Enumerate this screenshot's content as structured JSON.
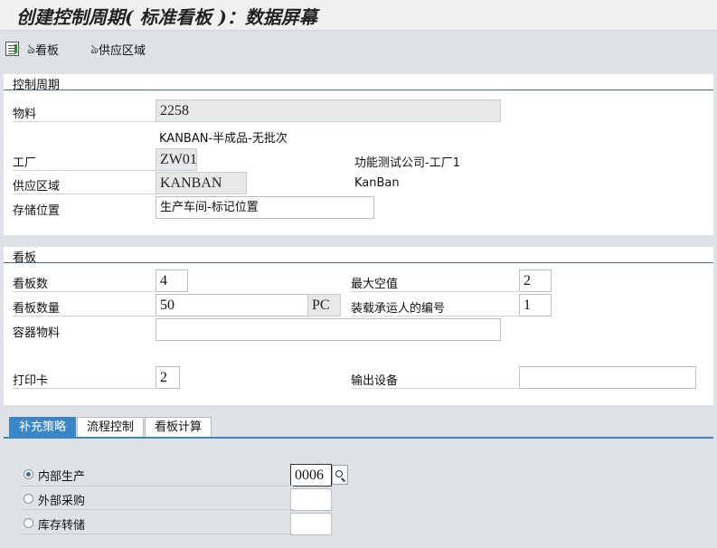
{
  "title": "创建控制周期( 标准看板 )：数据屏幕",
  "toolbar": {
    "items": [
      {
        "label": "看板",
        "icon": "glasses-icon"
      },
      {
        "label": "供应区域",
        "icon": "glasses-icon"
      }
    ]
  },
  "control_cycle": {
    "header": "控制周期",
    "material_label": "物料",
    "material_value": "2258",
    "material_desc": "KANBAN-半成品-无批次",
    "plant_label": "工厂",
    "plant_value": "ZW01",
    "plant_desc": "功能测试公司-工厂1",
    "supply_area_label": "供应区域",
    "supply_area_value": "KANBAN",
    "supply_area_desc": "KanBan",
    "storage_label": "存储位置",
    "storage_value": "生产车间-标记位置"
  },
  "kanban": {
    "header": "看板",
    "num_kanbans_label": "看板数",
    "num_kanbans_value": "4",
    "max_empty_label": "最大空值",
    "max_empty_value": "2",
    "kanban_qty_label": "看板数量",
    "kanban_qty_value": "50",
    "kanban_qty_unit": "PC",
    "carrier_label": "装载承运人的编号",
    "carrier_value": "1",
    "container_label": "容器物料",
    "container_value": "",
    "print_label": "打印卡",
    "print_value": "2",
    "output_label": "输出设备",
    "output_value": ""
  },
  "tabs": [
    {
      "label": "补充策略",
      "active": true
    },
    {
      "label": "流程控制",
      "active": false
    },
    {
      "label": "看板计算",
      "active": false
    }
  ],
  "strategy": {
    "options": [
      {
        "label": "内部生产",
        "value": "0006",
        "checked": true
      },
      {
        "label": "外部采购",
        "value": "",
        "checked": false
      },
      {
        "label": "库存转储",
        "value": "",
        "checked": false
      }
    ]
  },
  "colors": {
    "accent": "#3a87c8",
    "background": "#dfe3e8",
    "readonly_field": "#e6e8ea"
  }
}
